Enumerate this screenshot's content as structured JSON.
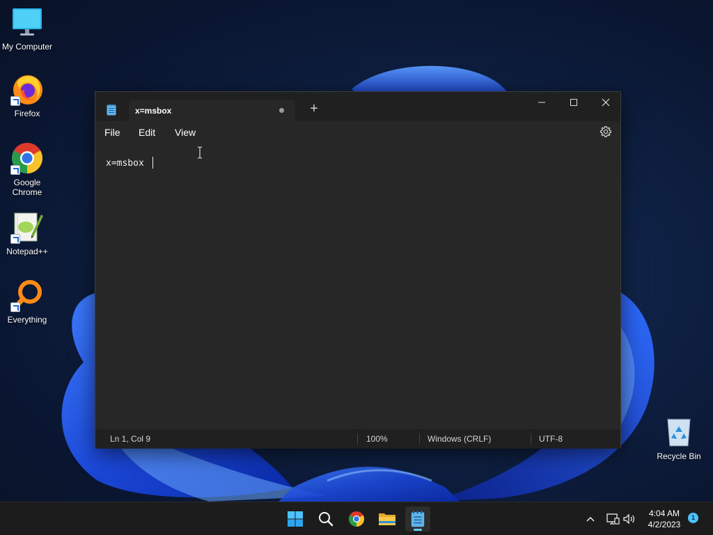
{
  "desktop": {
    "icons": [
      {
        "label": "My Computer"
      },
      {
        "label": "Firefox"
      },
      {
        "label": "Google Chrome"
      },
      {
        "label": "Notepad++"
      },
      {
        "label": "Everything"
      },
      {
        "label": "Recycle Bin"
      }
    ]
  },
  "notepad": {
    "tab_title": "x=msbox",
    "new_tab_symbol": "+",
    "menu": {
      "file": "File",
      "edit": "Edit",
      "view": "View"
    },
    "content": "x=msbox ",
    "status": {
      "position": "Ln 1, Col 9",
      "zoom": "100%",
      "line_ending": "Windows (CRLF)",
      "encoding": "UTF-8"
    }
  },
  "taskbar": {
    "apps": [
      "start-icon",
      "search-icon",
      "chrome-icon",
      "file-explorer-icon",
      "notepad-icon"
    ],
    "clock": {
      "time": "4:04 AM",
      "date": "4/2/2023"
    },
    "notification_count": "1"
  },
  "colors": {
    "window_bg": "#272727",
    "titlebar_bg": "#202020",
    "accent": "#60cdff",
    "taskbar_bg": "#1c1c1c"
  }
}
